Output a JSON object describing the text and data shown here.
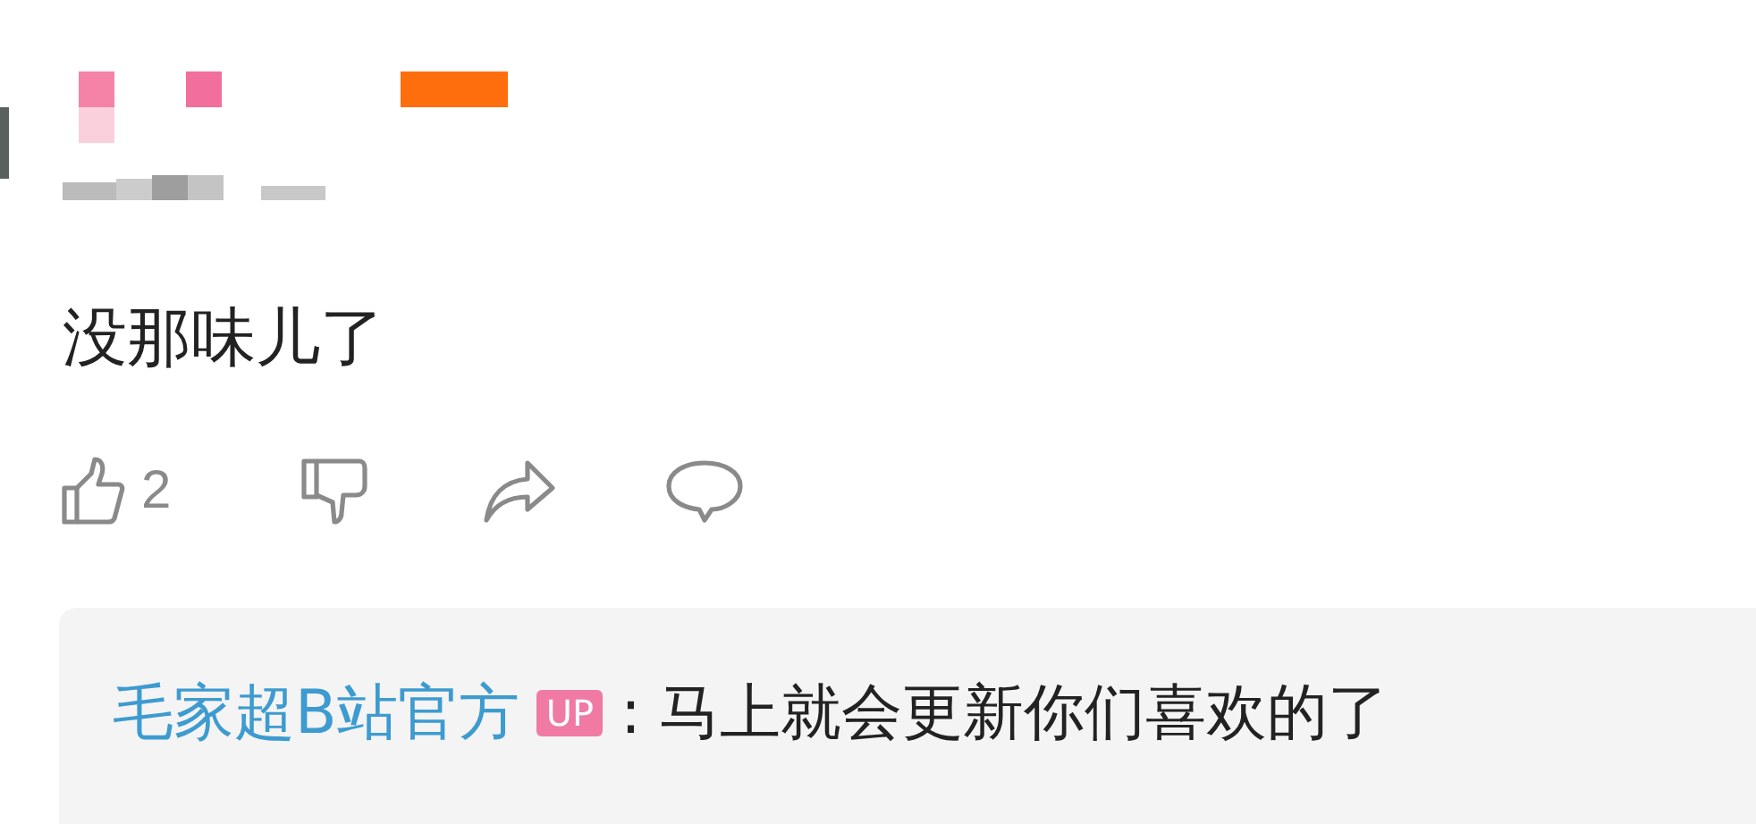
{
  "comment": {
    "text": "没那味儿了",
    "likes": "2"
  },
  "reply": {
    "author": "毛家超B站官方",
    "badge": "UP",
    "separator": ":",
    "text": "马上就会更新你们喜欢的了"
  }
}
